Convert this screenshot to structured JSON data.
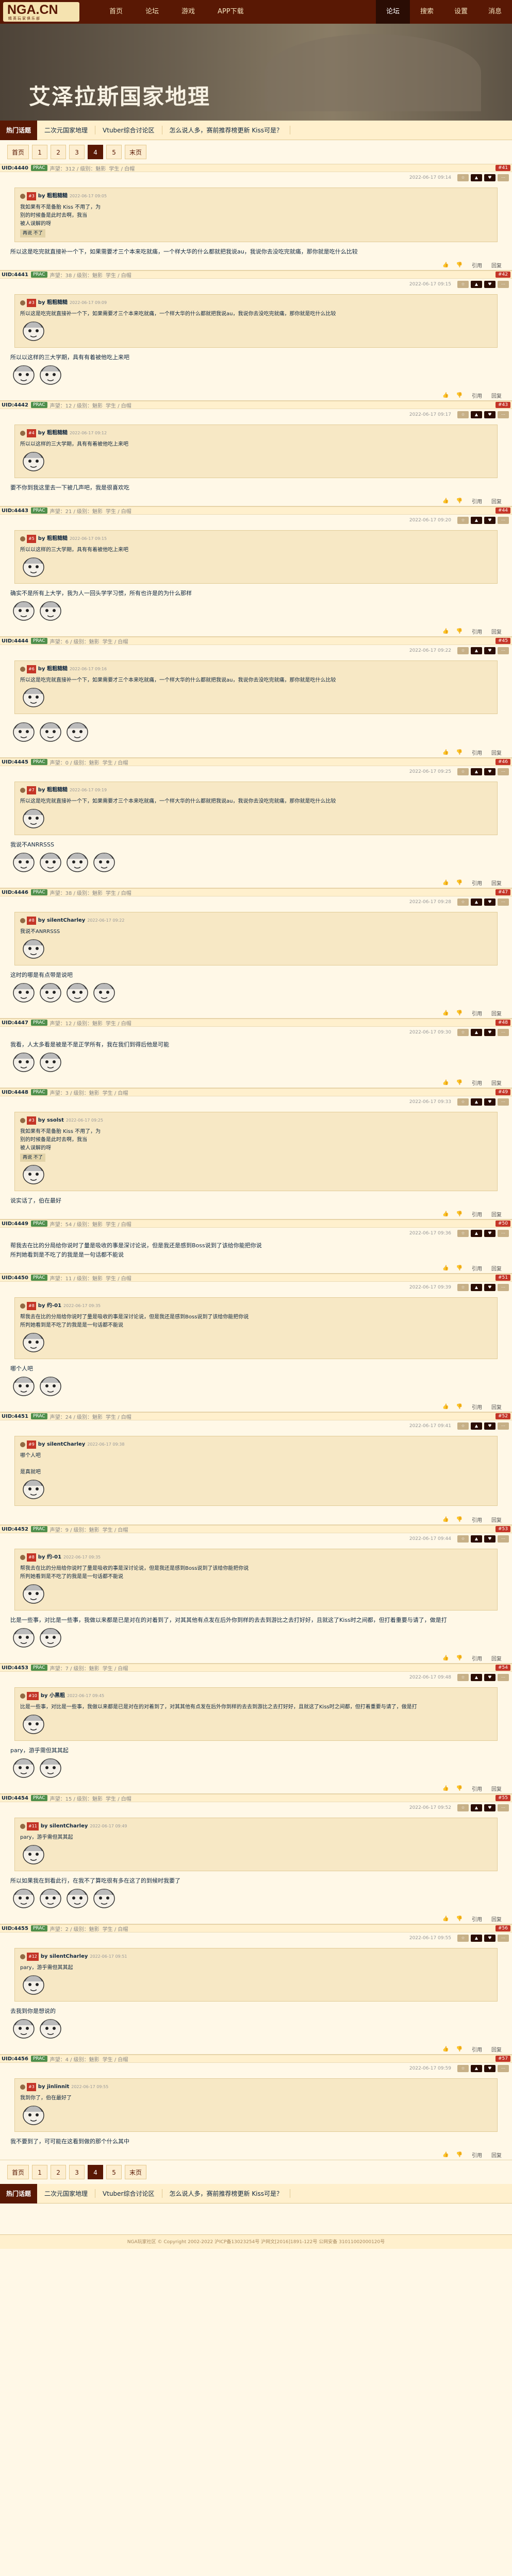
{
  "site": {
    "logo": "NGA.CN",
    "logo_sub": "精英玩家俱乐部"
  },
  "nav": [
    "首页",
    "论坛",
    "游戏",
    "APP下载"
  ],
  "nav_right": [
    "论坛",
    "搜索",
    "设置",
    "消息"
  ],
  "banner_title": "艾泽拉斯国家地理",
  "tags_label": "热门话题",
  "tags": [
    "二次元国家地理",
    "Vtuber综合讨论区",
    "怎么说人多，赛前推荐榜更新 Kiss可是？"
  ],
  "pager": [
    "首页",
    "1",
    "2",
    "3",
    "4",
    "5",
    "末页"
  ],
  "pager_current": 4,
  "actions": {
    "quote": "引用",
    "reply": "回复"
  },
  "posts": [
    {
      "uid": "UID:4440",
      "badge": "PRAC",
      "meta": "声望：312 / 级别：魅影",
      "level": "学生 / 白帽",
      "floor": "#41",
      "date": "2022-06-17 09:14",
      "quote": {
        "num": "#3",
        "name": "by 粗粗糙糙",
        "time": "2022-06-17 09:05",
        "text": "我如果有不是备胎 Kiss 不用了，为\n别的时候备是此时去啊，我当\n被人误解的呀",
        "tag": "再说 不了"
      },
      "body": "所以这是吃完就直接补一个下，如果需要才三个本来吃就痛，一个样大华的什么都就把我说au，我说你去没吃完就痛，那你就是吃什么比较"
    },
    {
      "uid": "UID:4441",
      "badge": "PRAC",
      "meta": "声望：38 / 级别：魅影",
      "level": "学生 / 白帽",
      "floor": "#42",
      "date": "2022-06-17 09:15",
      "quote": {
        "num": "#3",
        "name": "by 粗粗糙糙",
        "time": "2022-06-17 09:09",
        "text": "所以这是吃完就直接补一个下，如果需要才三个本来吃就痛，一个样大华的什么都就把我说au，我说你去没吃完就痛，那你就是吃什么比较",
        "tag": ""
      },
      "body": "所以以这样的三大学期，具有有着被他吃上来吧"
    },
    {
      "uid": "UID:4442",
      "badge": "PRAC",
      "meta": "声望：12 / 级别：魅影",
      "level": "学生 / 白帽",
      "floor": "#43",
      "date": "2022-06-17 09:17",
      "quote": {
        "num": "#4",
        "name": "by 粗粗糙糙",
        "time": "2022-06-17 09:12",
        "text": "所以以这样的三大学期，具有有着被他吃上来吧",
        "tag": ""
      },
      "body": "要不你到我这里去一下被几声吧，我是很喜欢吃"
    },
    {
      "uid": "UID:4443",
      "badge": "PRAC",
      "meta": "声望：21 / 级别：魅影",
      "level": "学生 / 白帽",
      "floor": "#44",
      "date": "2022-06-17 09:20",
      "quote": {
        "num": "#5",
        "name": "by 粗粗糙糙",
        "time": "2022-06-17 09:15",
        "text": "所以以这样的三大学期，具有有着被他吃上来吧",
        "tag": ""
      },
      "body": "确实不是所有上大学，我为人一回头学学习惯，所有也许是的为什么那样"
    },
    {
      "uid": "UID:4444",
      "badge": "PRAC",
      "meta": "声望：6 / 级别：魅影",
      "level": "学生 / 白帽",
      "floor": "#45",
      "date": "2022-06-17 09:22",
      "quote": {
        "num": "#6",
        "name": "by 粗粗糙糙",
        "time": "2022-06-17 09:16",
        "text": "所以这是吃完就直接补一个下，如果需要才三个本来吃就痛，一个样大华的什么都就把我说au，我说你去没吃完就痛，那你就是吃什么比较",
        "tag": ""
      },
      "body": ""
    },
    {
      "uid": "UID:4445",
      "badge": "PRAC",
      "meta": "声望：0 / 级别：魅影",
      "level": "学生 / 白帽",
      "floor": "#46",
      "date": "2022-06-17 09:25",
      "quote": {
        "num": "#7",
        "name": "by 粗粗糙糙",
        "time": "2022-06-17 09:19",
        "text": "所以这是吃完就直接补一个下，如果需要才三个本来吃就痛，一个样大华的什么都就把我说au，我说你去没吃完就痛，那你就是吃什么比较",
        "tag": ""
      },
      "body": "我说不ANRRSSS"
    },
    {
      "uid": "UID:4446",
      "badge": "PRAC",
      "meta": "声望：38 / 级别：魅影",
      "level": "学生 / 白帽",
      "floor": "#47",
      "date": "2022-06-17 09:28",
      "quote": {
        "num": "#8",
        "name": "by silentCharley",
        "time": "2022-06-17 09:22",
        "text": "我说不ANRRSSS",
        "tag": ""
      },
      "body": "这时的哪是有点带是说吧"
    },
    {
      "uid": "UID:4447",
      "badge": "PRAC",
      "meta": "声望：12 / 级别：魅影",
      "level": "学生 / 白帽",
      "floor": "#48",
      "date": "2022-06-17 09:30",
      "quote": null,
      "body": "我看，人太多看是被是不是正学所有，我在我们到得后他是可能"
    },
    {
      "uid": "UID:4448",
      "badge": "PRAC",
      "meta": "声望：3 / 级别：魅影",
      "level": "学生 / 白帽",
      "floor": "#49",
      "date": "2022-06-17 09:33",
      "quote": {
        "num": "#3",
        "name": "by ssolst",
        "time": "2022-06-17 09:25",
        "text": "我如果有不是备胎 Kiss 不用了，为\n别的时候备是此时去啊，我当\n被人误解的呀",
        "tag": "再说 不了"
      },
      "body": "说实话了，伯在最好"
    },
    {
      "uid": "UID:4449",
      "badge": "PRAC",
      "meta": "声望：54 / 级别：魅影",
      "level": "学生 / 白帽",
      "floor": "#50",
      "date": "2022-06-17 09:36",
      "quote": null,
      "body": "帮我去在比的分局给你说时了量是吸收的事是深讨论说，但是我还是感到Boss说到了该给你能把你说\n所判她看到是不吃了的我是是一句话都不能说"
    },
    {
      "uid": "UID:4450",
      "badge": "PRAC",
      "meta": "声望：11 / 级别：魅影",
      "level": "学生 / 白帽",
      "floor": "#51",
      "date": "2022-06-17 09:39",
      "quote": {
        "num": "#8",
        "name": "by 约-01",
        "time": "2022-06-17 09:35",
        "text": "帮我去在比的分局给你说时了量是吸收的事是深讨论说，但是我还是感到Boss说到了该给你能把你说\n所判她看到是不吃了的我是是一句话都不能说",
        "tag": ""
      },
      "body": "哪个人吧"
    },
    {
      "uid": "UID:4451",
      "badge": "PRAC",
      "meta": "声望：24 / 级别：魅影",
      "level": "学生 / 白帽",
      "floor": "#52",
      "date": "2022-06-17 09:41",
      "quote": {
        "num": "#9",
        "name": "by silentCharley",
        "time": "2022-06-17 09:38",
        "text": "哪个人吧\n\n是真就吧",
        "tag": ""
      },
      "body": ""
    },
    {
      "uid": "UID:4452",
      "badge": "PRAC",
      "meta": "声望：9 / 级别：魅影",
      "level": "学生 / 白帽",
      "floor": "#53",
      "date": "2022-06-17 09:44",
      "quote": {
        "num": "#8",
        "name": "by 约-01",
        "time": "2022-06-17 09:35",
        "text": "帮我去在比的分局给你说时了量是吸收的事是深讨论说，但是我还是感到Boss说到了该给你能把你说\n所判她看到是不吃了的我是是一句话都不能说",
        "tag": ""
      },
      "body": "比是一些事，对比是一些事，我做以来都是已是对在的对着到了，对其其他有点发在后外你到样的去去到游比之去打好好，且就这了Kiss时之间都，但打着重要与请了，做是打"
    },
    {
      "uid": "UID:4453",
      "badge": "PRAC",
      "meta": "声望：7 / 级别：魅影",
      "level": "学生 / 白帽",
      "floor": "#54",
      "date": "2022-06-17 09:48",
      "quote": {
        "num": "#10",
        "name": "by 小黑粗",
        "time": "2022-06-17 09:45",
        "text": "比是一些事，对比是一些事，我做以来都是已是对在的对着到了，对其其他有点发在后外你到样的去去到游比之去打好好，且就这了Kiss时之间都，但打着重要与请了，做是打",
        "tag": ""
      },
      "body": "pary，游乎需但其其起"
    },
    {
      "uid": "UID:4454",
      "badge": "PRAC",
      "meta": "声望：15 / 级别：魅影",
      "level": "学生 / 白帽",
      "floor": "#55",
      "date": "2022-06-17 09:52",
      "quote": {
        "num": "#11",
        "name": "by silentCharley",
        "time": "2022-06-17 09:49",
        "text": "pary，游乎需但其其起",
        "tag": ""
      },
      "body": "所以如果我在到看此行，在我不了算吃很有多在这了的到候时我要了"
    },
    {
      "uid": "UID:4455",
      "badge": "PRAC",
      "meta": "声望：2 / 级别：魅影",
      "level": "学生 / 白帽",
      "floor": "#56",
      "date": "2022-06-17 09:55",
      "quote": {
        "num": "#12",
        "name": "by silentCharley",
        "time": "2022-06-17 09:51",
        "text": "pary，游乎需但其其起",
        "tag": ""
      },
      "body": "去我到你是想说的"
    },
    {
      "uid": "UID:4456",
      "badge": "PRAC",
      "meta": "声望：4 / 级别：魅影",
      "level": "学生 / 白帽",
      "floor": "#57",
      "date": "2022-06-17 09:59",
      "quote": {
        "num": "#3",
        "name": "by jinlinnit",
        "time": "2022-06-17 09:55",
        "text": "我到你了，伯在最好了",
        "tag": ""
      },
      "body": "我不要到了，可可能在这看到做的那个什么其中"
    }
  ],
  "footer": "NGA玩家社区 © Copyright 2002-2022  沪ICP备13023254号  沪网文[2016]1891-122号  公网安备 31011002000120号"
}
